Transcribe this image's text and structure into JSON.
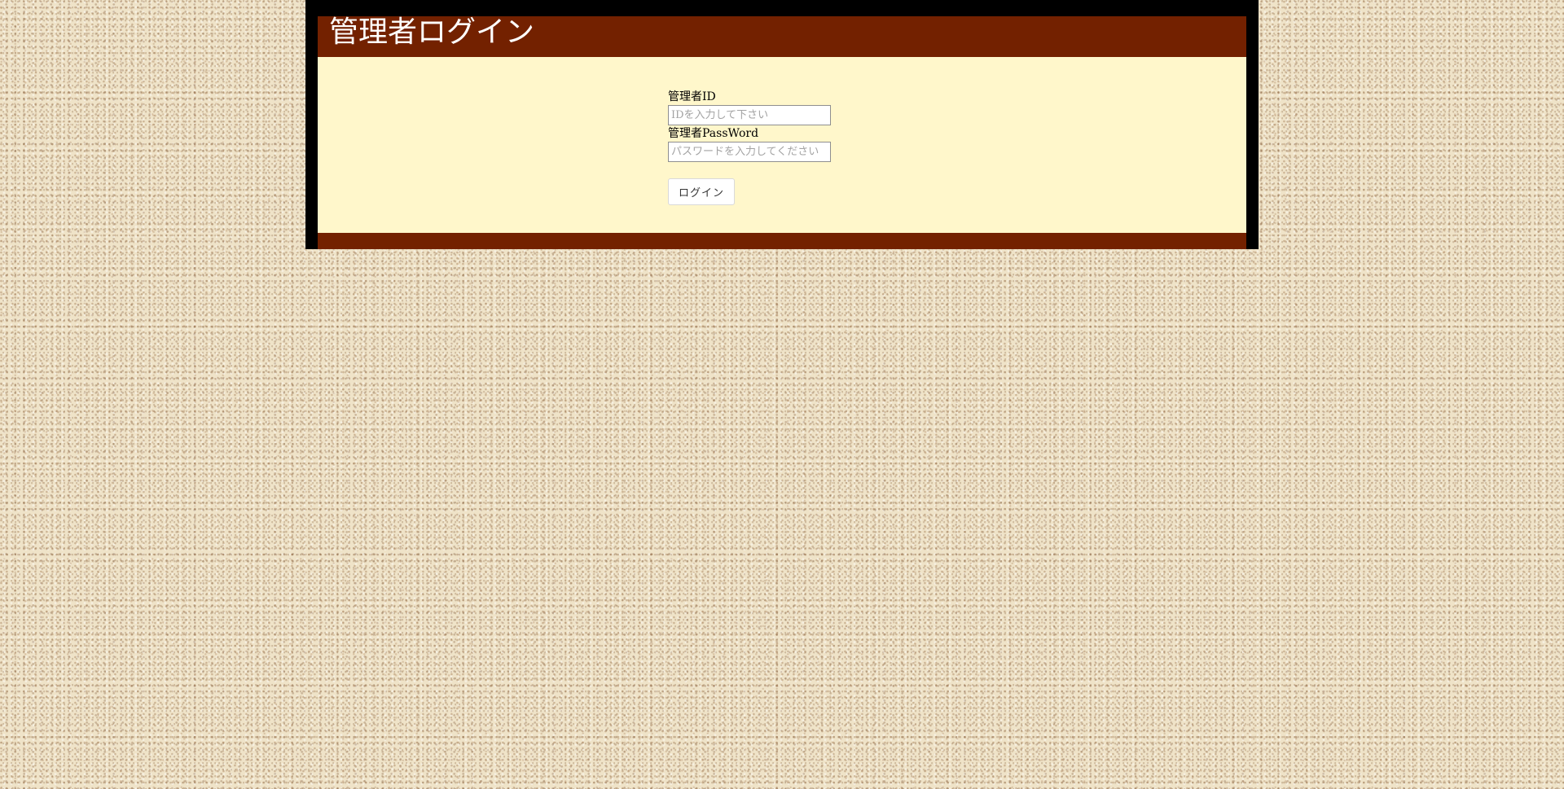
{
  "header": {
    "title": "管理者ログイン"
  },
  "login_form": {
    "id_label": "管理者ID",
    "id_value": "",
    "id_placeholder": "IDを入力して下さい",
    "password_label": "管理者PassWord",
    "password_value": "",
    "password_placeholder": "パスワードを入力してください",
    "submit_label": "ログイン"
  },
  "colors": {
    "header_background": "#732100",
    "content_background": "#fff7cb",
    "frame_background": "#000000",
    "title_text": "#ffffff"
  }
}
